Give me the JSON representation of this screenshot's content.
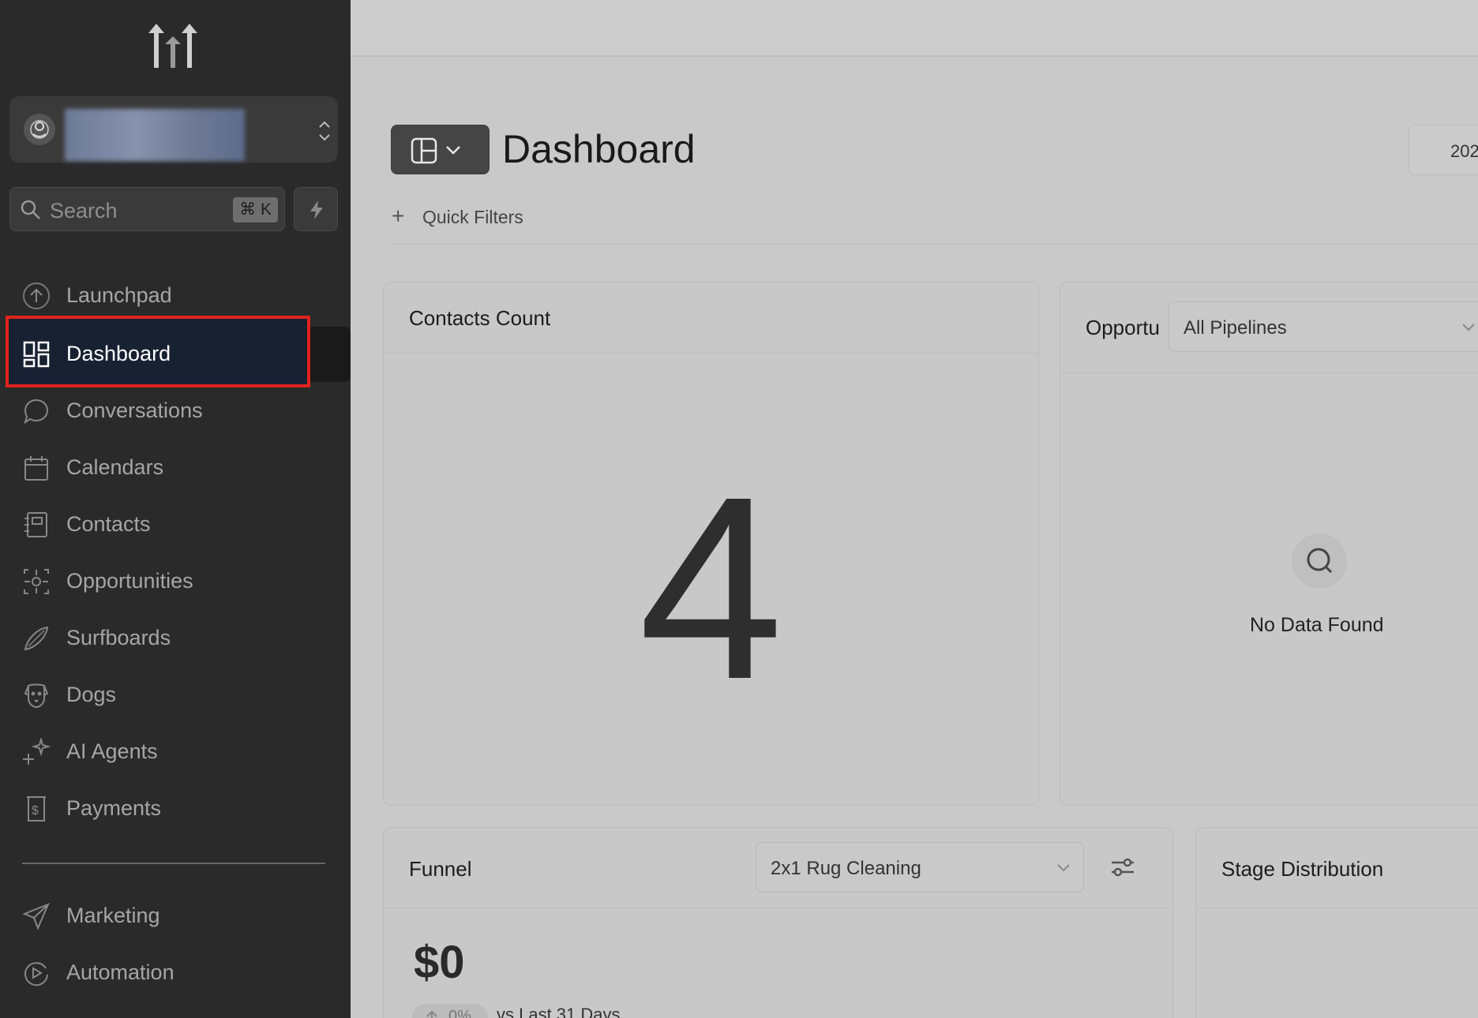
{
  "sidebar": {
    "logo": "highlevel-logo",
    "search": {
      "placeholder": "Search",
      "shortcut": "⌘ K"
    },
    "items": [
      {
        "label": "Launchpad",
        "icon": "launchpad-icon"
      },
      {
        "label": "Dashboard",
        "icon": "dashboard-icon",
        "active": true
      },
      {
        "label": "Conversations",
        "icon": "chat-bubble-icon"
      },
      {
        "label": "Calendars",
        "icon": "calendar-icon"
      },
      {
        "label": "Contacts",
        "icon": "contacts-book-icon"
      },
      {
        "label": "Opportunities",
        "icon": "opportunities-icon"
      },
      {
        "label": "Surfboards",
        "icon": "surfboard-icon"
      },
      {
        "label": "Dogs",
        "icon": "dog-icon"
      },
      {
        "label": "AI Agents",
        "icon": "sparkle-icon"
      },
      {
        "label": "Payments",
        "icon": "payments-icon"
      }
    ],
    "secondary_items": [
      {
        "label": "Marketing",
        "icon": "paper-plane-icon"
      },
      {
        "label": "Automation",
        "icon": "automation-icon"
      }
    ]
  },
  "main": {
    "title": "Dashboard",
    "date_partial": "202",
    "quick_filters": {
      "icon": "+",
      "label": "Quick Filters"
    }
  },
  "cards": {
    "contacts_count": {
      "title": "Contacts Count",
      "value": "4"
    },
    "opportunities": {
      "title": "Opportu",
      "select_value": "All Pipelines",
      "empty_text": "No Data Found"
    },
    "funnel": {
      "title": "Funnel",
      "select_value": "2x1 Rug Cleaning",
      "amount": "$0",
      "trend": "0%",
      "comparison": "vs Last 31 Days"
    },
    "stage_distribution": {
      "title": "Stage Distribution"
    }
  },
  "colors": {
    "sidebar_bg": "#2a2a2a",
    "active_item_bg": "#182132",
    "highlight_border": "#e0231c",
    "main_bg": "#c9c9c9"
  }
}
